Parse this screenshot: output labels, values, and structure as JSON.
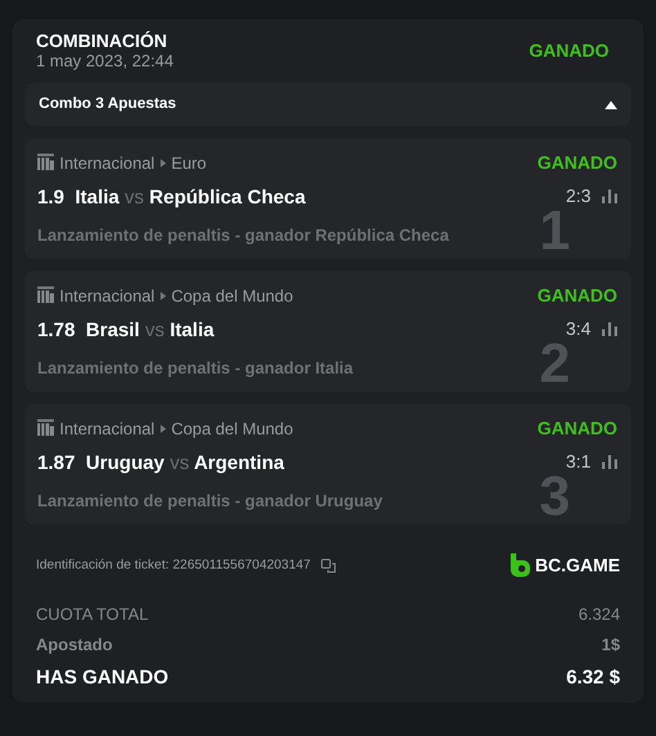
{
  "header": {
    "title": "COMBINACIÓN",
    "date": "1 may 2023, 22:44",
    "status": "GANADO"
  },
  "combo": {
    "label": "Combo 3 Apuestas",
    "expanded": true
  },
  "legs": [
    {
      "category": "Internacional",
      "league": "Euro",
      "status": "GANADO",
      "odds": "1.9",
      "home": "Italia",
      "vs": "vs",
      "away": "República Checa",
      "score": "2:3",
      "market": "Lanzamiento de penaltis - ganador República Checa",
      "number": "1"
    },
    {
      "category": "Internacional",
      "league": "Copa del Mundo",
      "status": "GANADO",
      "odds": "1.78",
      "home": "Brasil",
      "vs": "vs",
      "away": "Italia",
      "score": "3:4",
      "market": "Lanzamiento de penaltis - ganador Italia",
      "number": "2"
    },
    {
      "category": "Internacional",
      "league": "Copa del Mundo",
      "status": "GANADO",
      "odds": "1.87",
      "home": "Uruguay",
      "vs": "vs",
      "away": "Argentina",
      "score": "3:1",
      "market": "Lanzamiento de penaltis - ganador Uruguay",
      "number": "3"
    }
  ],
  "ticket": {
    "label": "Identificación de ticket: 2265011556704203147",
    "brand": "BC.GAME"
  },
  "summary": [
    {
      "kind": "muted",
      "label": "CUOTA TOTAL",
      "value": "6.324"
    },
    {
      "kind": "plain",
      "label": "Apostado",
      "value": "1$"
    },
    {
      "kind": "total",
      "label": "HAS GANADO",
      "value": "6.32 $"
    }
  ]
}
